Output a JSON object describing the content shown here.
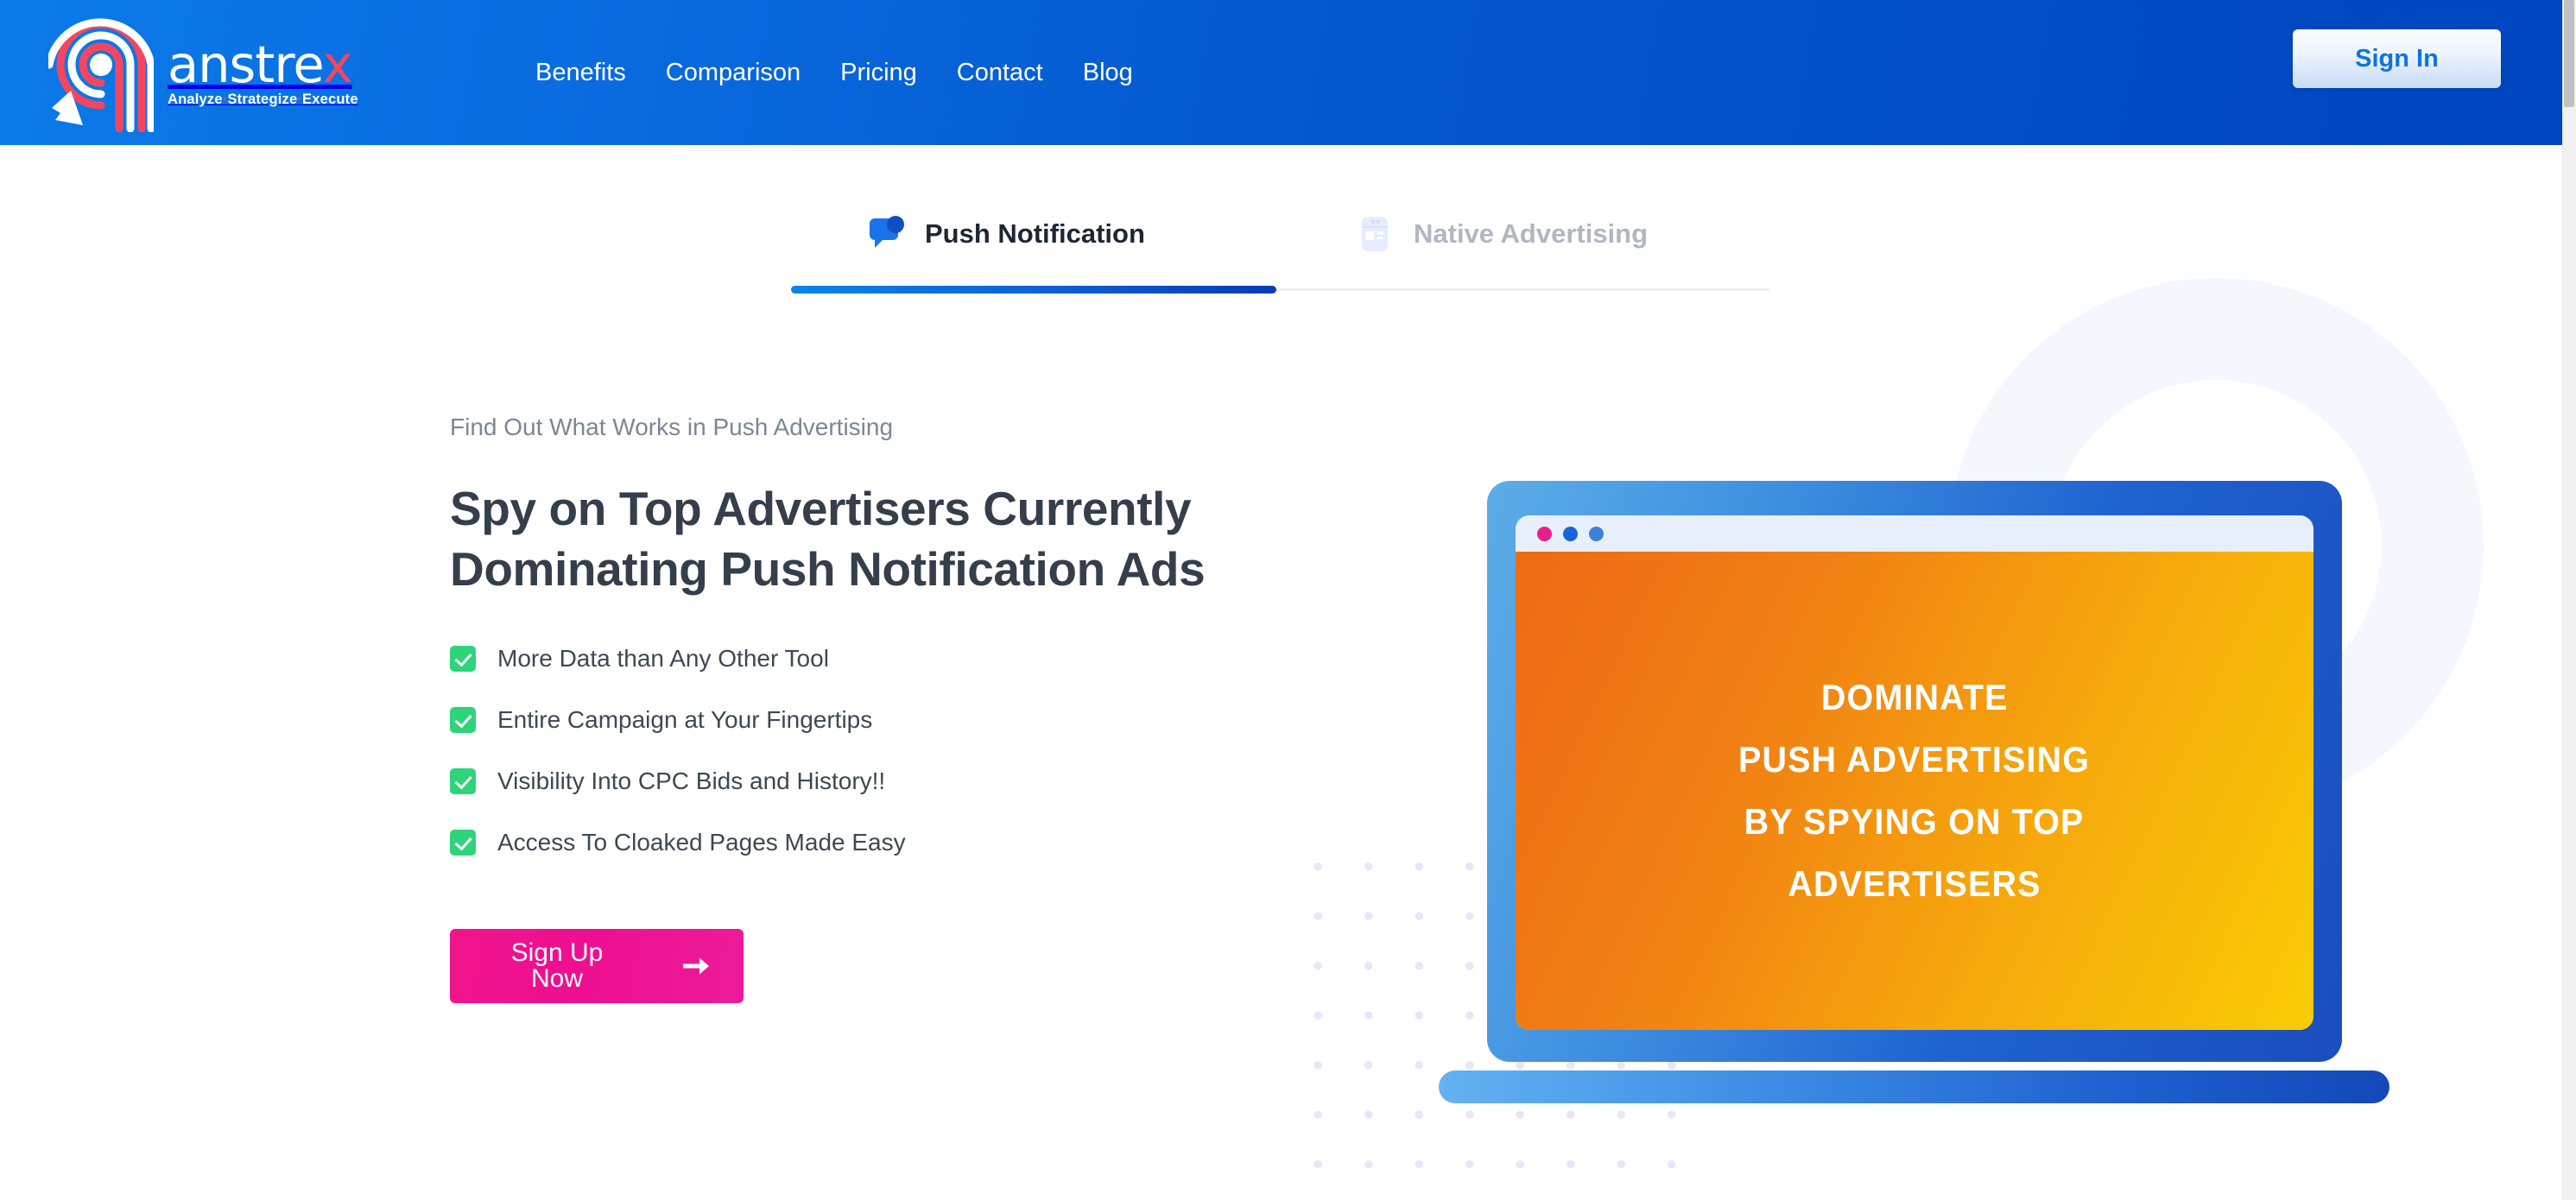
{
  "header": {
    "logo": {
      "wordmark_main": "anstre",
      "wordmark_accent": "x",
      "tagline_part1": "Analyze",
      "tagline_sep1": "·",
      "tagline_part2": "Strategize",
      "tagline_sep2": "·",
      "tagline_part3": "Execute",
      "icon_name": "anstrex-spiral-head-logo"
    },
    "nav": [
      {
        "label": "Benefits"
      },
      {
        "label": "Comparison"
      },
      {
        "label": "Pricing"
      },
      {
        "label": "Contact"
      },
      {
        "label": "Blog"
      }
    ],
    "signin_label": "Sign In",
    "colors": {
      "gradient_start": "#0b7ae8",
      "gradient_end": "#0046c0",
      "signin_text": "#0d74e0"
    }
  },
  "tabs": [
    {
      "label": "Push Notification",
      "icon_name": "push-notification-bubble-icon",
      "active": true,
      "underline_gradient_start": "#0a84e8",
      "underline_gradient_end": "#0a3bb5"
    },
    {
      "label": "Native Advertising",
      "icon_name": "native-ad-card-icon",
      "active": false
    }
  ],
  "hero": {
    "eyebrow": "Find Out What Works in Push Advertising",
    "title": "Spy on Top Advertisers Currently Dominating Push Notification Ads",
    "features": [
      {
        "label": "More Data than Any Other Tool"
      },
      {
        "label": "Entire Campaign at Your Fingertips"
      },
      {
        "label": "Visibility Into CPC Bids and History!!"
      },
      {
        "label": "Access To Cloaked Pages Made Easy"
      }
    ],
    "cta_label": "Sign Up Now",
    "cta_icon_name": "arrow-right-icon",
    "colors": {
      "check": "#2ed47a",
      "cta_start": "#f0148c",
      "cta_end": "#ec1b99",
      "title": "#343f4b",
      "eyebrow": "#7b8794"
    }
  },
  "illustration": {
    "name": "laptop-mockup",
    "browser_dots": [
      "#e91e8c",
      "#1565d8",
      "#3b82d9"
    ],
    "screen_lines": [
      "DOMINATE",
      "PUSH ADVERTISING",
      "BY SPYING ON TOP",
      "ADVERTISERS"
    ],
    "screen_gradient_start": "#ef6a16",
    "screen_gradient_end": "#f9cc05",
    "frame_gradient_start": "#5dade8",
    "frame_gradient_end": "#1b4dbe"
  },
  "decor": {
    "ring_color": "#f4f7fd",
    "dot_grid_color": "#e9e6f7"
  }
}
